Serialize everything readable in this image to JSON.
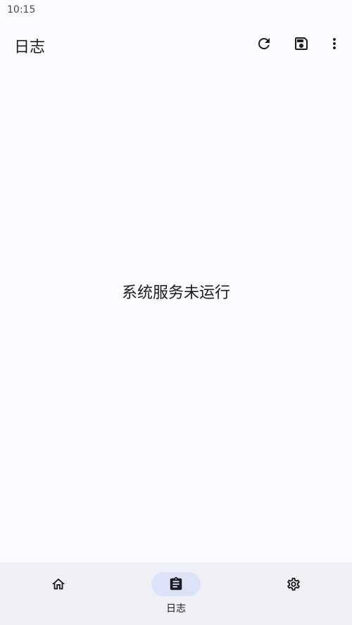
{
  "status_bar": {
    "time": "10:15"
  },
  "app_bar": {
    "title": "日志",
    "actions": [
      {
        "icon": "refresh-icon"
      },
      {
        "icon": "save-icon"
      },
      {
        "icon": "more-vert-icon"
      }
    ]
  },
  "content": {
    "empty_message": "系统服务未运行"
  },
  "bottom_nav": {
    "items": [
      {
        "icon": "home-icon",
        "label": "",
        "active": false
      },
      {
        "icon": "clipboard-icon",
        "label": "日志",
        "active": true
      },
      {
        "icon": "settings-icon",
        "label": "",
        "active": false
      }
    ]
  },
  "colors": {
    "background": "#fcfbff",
    "nav_background": "#efeff6",
    "nav_indicator": "#dce3f9",
    "text": "#1c1b1f"
  }
}
